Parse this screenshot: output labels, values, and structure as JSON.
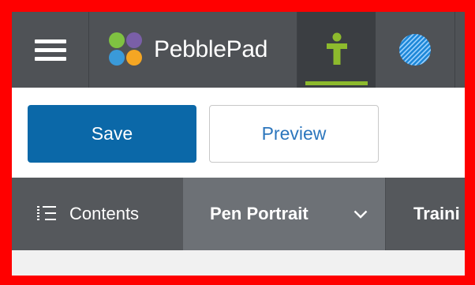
{
  "app": {
    "brand_name": "PebblePad"
  },
  "topbar": {
    "menu_icon": "hamburger-menu-icon",
    "user_tab_icon": "person-icon",
    "globe_tab_icon": "globe-icon"
  },
  "toolbar": {
    "save_label": "Save",
    "preview_label": "Preview"
  },
  "navbar": {
    "contents_label": "Contents",
    "contents_icon": "list-icon",
    "current_page_label": "Pen Portrait",
    "next_page_label": "Traini"
  },
  "colors": {
    "topbar_bg": "#4f5256",
    "accent_green": "#8dba2d",
    "save_blue": "#0b68a8",
    "preview_text_blue": "#2c76bd",
    "frame_red": "#ff0000"
  }
}
